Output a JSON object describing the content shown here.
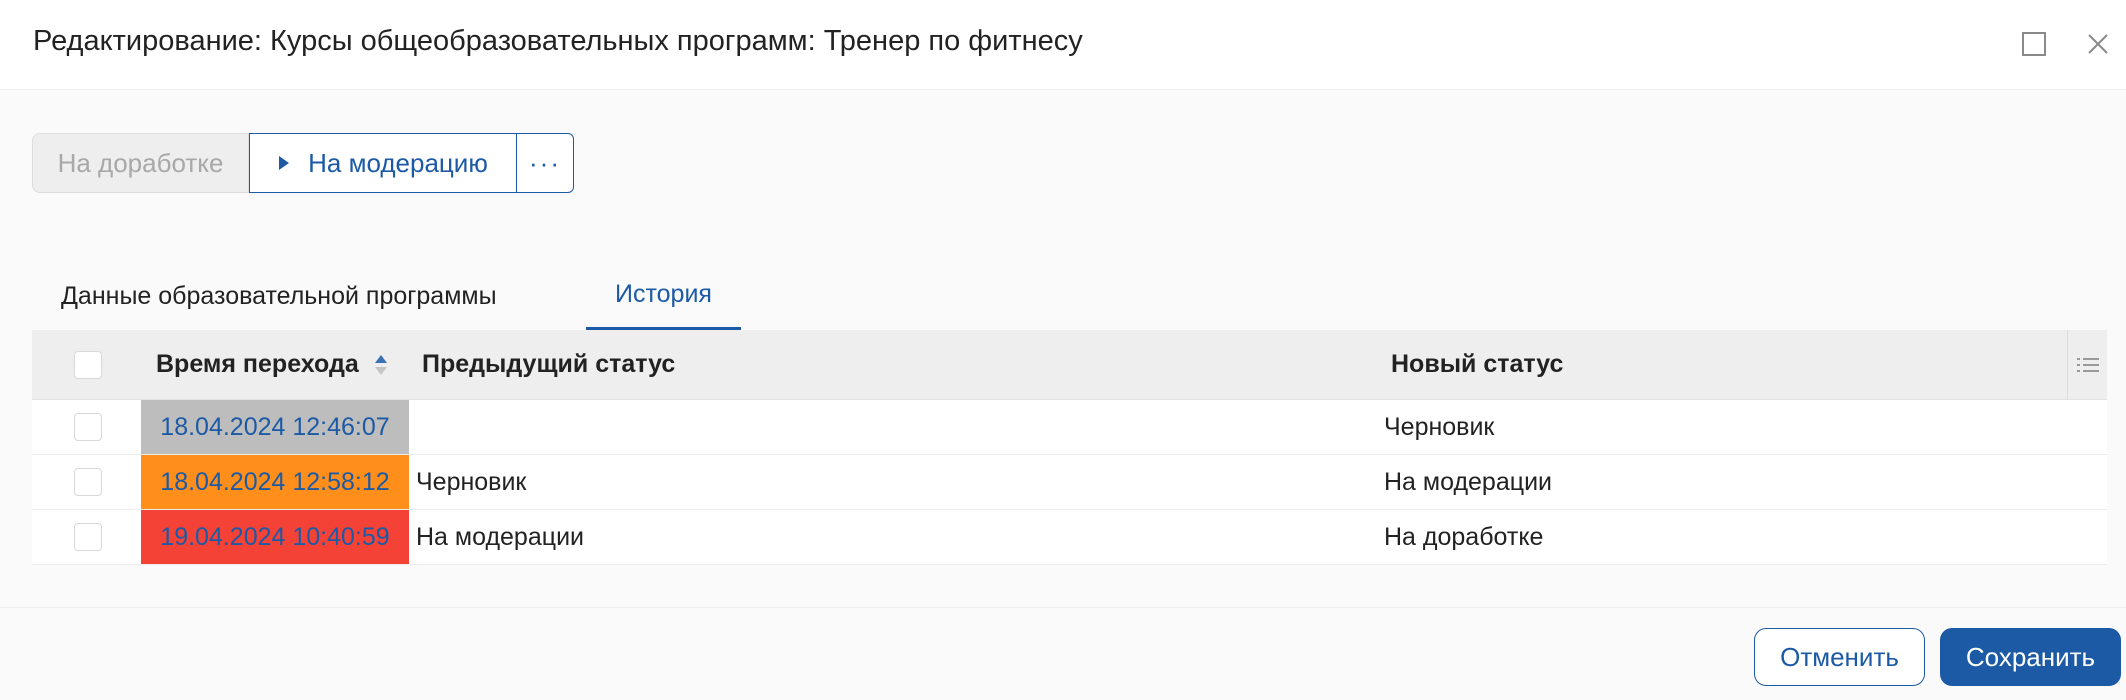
{
  "window": {
    "title": "Редактирование: Курсы общеобразовательных программ: Тренер по фитнесу",
    "maximize_icon": "maximize-icon",
    "close_icon": "close-icon"
  },
  "actions": {
    "rework_label": "На доработке",
    "moderation_label": "На модерацию",
    "more_label": "···"
  },
  "tabs": [
    {
      "label": "Данные образовательной программы",
      "active": false
    },
    {
      "label": "История",
      "active": true
    }
  ],
  "table": {
    "headers": {
      "time": "Время перехода",
      "previous_status": "Предыдущий статус",
      "new_status": "Новый статус"
    },
    "sort": "ascending",
    "rows": [
      {
        "time": "18.04.2024 12:46:07",
        "previous_status": "",
        "new_status": "Черновик",
        "color": "#bdbdbd"
      },
      {
        "time": "18.04.2024 12:58:12",
        "previous_status": "Черновик",
        "new_status": "На модерации",
        "color": "#ff8f1a"
      },
      {
        "time": "19.04.2024 10:40:59",
        "previous_status": "На модерации",
        "new_status": "На доработке",
        "color": "#f44336"
      }
    ]
  },
  "footer": {
    "cancel_label": "Отменить",
    "save_label": "Сохранить"
  },
  "colors": {
    "accent": "#1c5aa6"
  }
}
